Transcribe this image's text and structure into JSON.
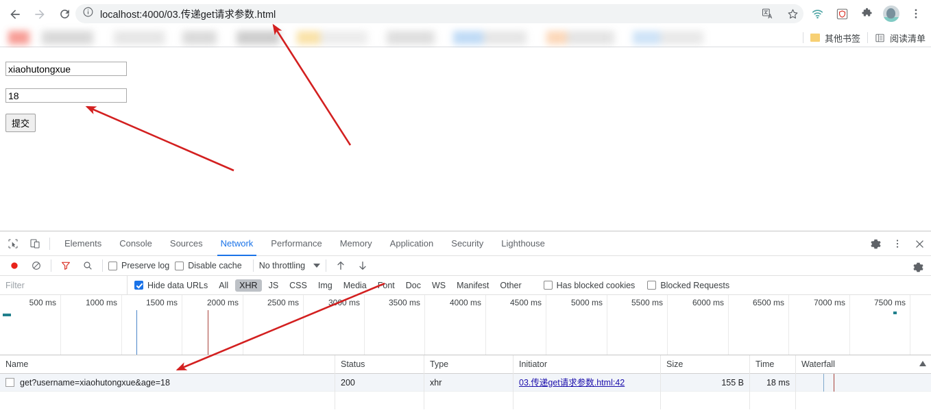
{
  "browser": {
    "nav": {
      "back": "back-arrow",
      "forward": "forward-arrow",
      "reload": "reload"
    },
    "omnibox": {
      "url": "localhost:4000/03.传递get请求参数.html",
      "info_icon": "info-circle-icon"
    },
    "toolbar_icons": [
      "translate-icon",
      "bookmark-star-icon",
      "wifi-icon",
      "shield-icon",
      "extensions-puzzle-icon",
      "profile-avatar",
      "chrome-menu-icon"
    ],
    "bookmarks": {
      "other_bookmarks": "其他书签",
      "reading_list": "阅读清单"
    }
  },
  "page": {
    "username_value": "xiaohutongxue",
    "age_value": "18",
    "submit_label": "提交"
  },
  "devtools": {
    "tabs": [
      {
        "label": "Elements",
        "active": false
      },
      {
        "label": "Console",
        "active": false
      },
      {
        "label": "Sources",
        "active": false
      },
      {
        "label": "Network",
        "active": true
      },
      {
        "label": "Performance",
        "active": false
      },
      {
        "label": "Memory",
        "active": false
      },
      {
        "label": "Application",
        "active": false
      },
      {
        "label": "Security",
        "active": false
      },
      {
        "label": "Lighthouse",
        "active": false
      }
    ],
    "tab_icons": [
      "inspect-element-icon",
      "device-toolbar-icon"
    ],
    "tabbar_right_icons": [
      "settings-gear-icon",
      "more-options-icon",
      "close-icon"
    ],
    "toolbar": {
      "record_icon": "record-button",
      "clear_icon": "clear-icon",
      "filter_icon": "filter-funnel-icon",
      "search_icon": "search-icon",
      "preserve_log": {
        "label": "Preserve log",
        "checked": false
      },
      "disable_cache": {
        "label": "Disable cache",
        "checked": false
      },
      "throttling": "No throttling",
      "import_icon": "import-har-icon",
      "export_icon": "export-har-icon",
      "settings_icon": "network-settings-gear-icon"
    },
    "filterbar": {
      "filter_placeholder": "Filter",
      "hide_data_urls": {
        "label": "Hide data URLs",
        "checked": true
      },
      "types": [
        "All",
        "XHR",
        "JS",
        "CSS",
        "Img",
        "Media",
        "Font",
        "Doc",
        "WS",
        "Manifest",
        "Other"
      ],
      "selected_type": "XHR",
      "has_blocked_cookies": {
        "label": "Has blocked cookies",
        "checked": false
      },
      "blocked_requests": {
        "label": "Blocked Requests",
        "checked": false
      }
    },
    "timeline": {
      "ticks": [
        "500 ms",
        "1000 ms",
        "1500 ms",
        "2000 ms",
        "2500 ms",
        "3000 ms",
        "3500 ms",
        "4000 ms",
        "4500 ms",
        "5000 ms",
        "5500 ms",
        "6000 ms",
        "6500 ms",
        "7000 ms",
        "7500 ms"
      ],
      "dom_content_loaded_color": "#1a73e8",
      "load_event_color": "#a8423a"
    },
    "table": {
      "columns": [
        "Name",
        "Status",
        "Type",
        "Initiator",
        "Size",
        "Time",
        "Waterfall"
      ],
      "rows": [
        {
          "name": "get?username=xiaohutongxue&age=18",
          "status": "200",
          "type": "xhr",
          "initiator": "03.传递get请求参数.html:42",
          "size": "155 B",
          "time": "18 ms"
        }
      ]
    }
  },
  "annotations": {
    "arrow_color": "#d32020",
    "arrows": [
      {
        "name": "arrow-to-url",
        "from": [
          511,
          212
        ],
        "to": [
          399,
          37
        ]
      },
      {
        "name": "arrow-to-age-input",
        "from": [
          341,
          249
        ],
        "to": [
          127,
          156
        ]
      },
      {
        "name": "arrow-to-request-name",
        "from": [
          561,
          414
        ],
        "to": [
          259,
          540
        ]
      }
    ]
  }
}
